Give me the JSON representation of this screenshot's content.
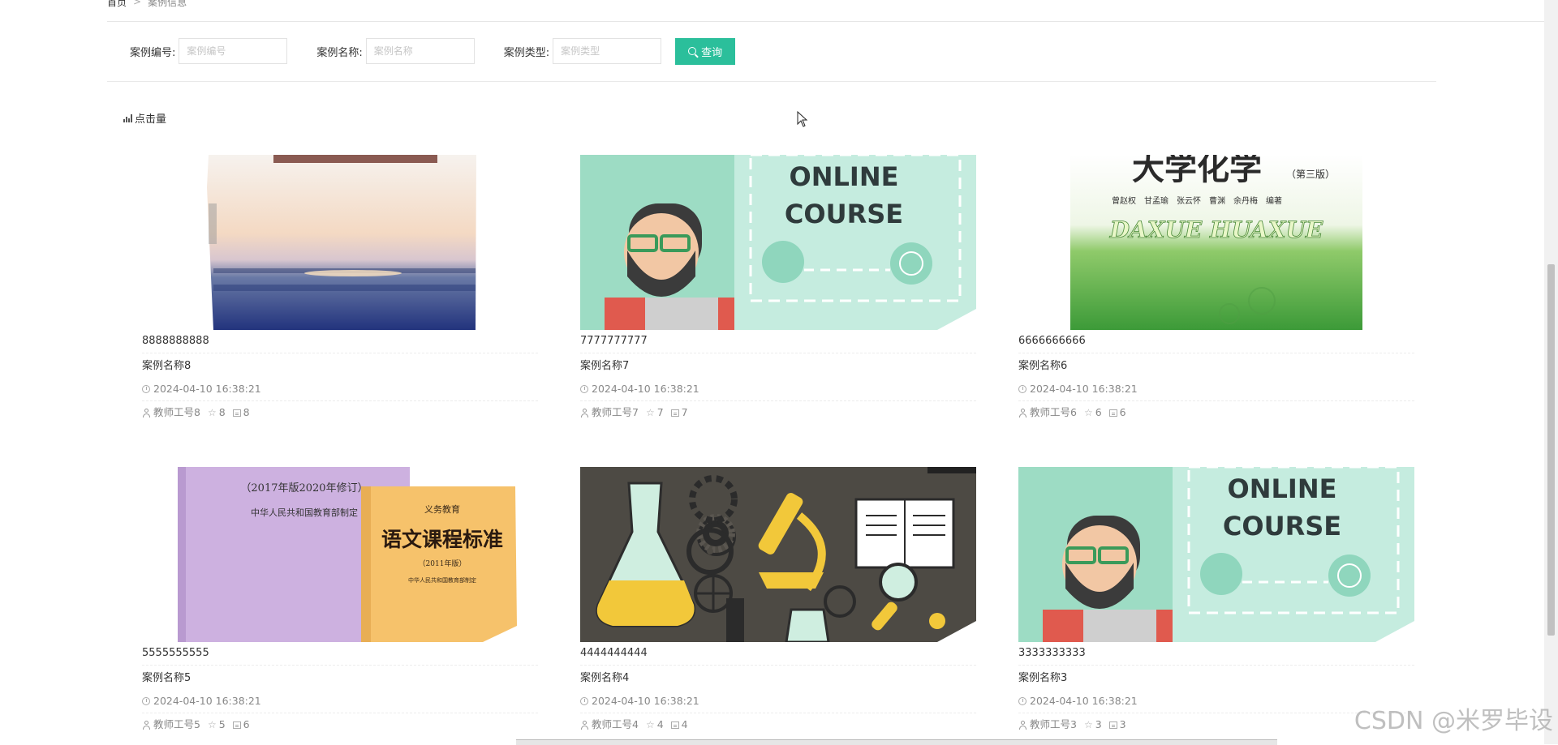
{
  "breadcrumb": {
    "home": "首页",
    "separator": ">",
    "current": "案例信息"
  },
  "search": {
    "fields": [
      {
        "label": "案例编号:",
        "placeholder": "案例编号"
      },
      {
        "label": "案例名称:",
        "placeholder": "案例名称"
      },
      {
        "label": "案例类型:",
        "placeholder": "案例类型"
      }
    ],
    "button_label": "查询"
  },
  "sort": {
    "label": "点击量"
  },
  "cards": [
    {
      "code": "8888888888",
      "name": "案例名称8",
      "time": "2024-04-10 16:38:21",
      "teacher": "教师工号8",
      "stars": "8",
      "comments": "8",
      "image": "textbook-seascape"
    },
    {
      "code": "7777777777",
      "name": "案例名称7",
      "time": "2024-04-10 16:38:21",
      "teacher": "教师工号7",
      "stars": "7",
      "comments": "7",
      "image": "online-course",
      "image_text": [
        "ONLINE",
        "COURSE"
      ]
    },
    {
      "code": "6666666666",
      "name": "案例名称6",
      "time": "2024-04-10 16:38:21",
      "teacher": "教师工号6",
      "stars": "6",
      "comments": "6",
      "image": "chemistry-book",
      "image_text": [
        "大学化学",
        "（第三版）",
        "DAXUE HUAXUE",
        "曾赵权　甘孟瑜　张云怀　曹渊　余丹梅　编著"
      ]
    },
    {
      "code": "5555555555",
      "name": "案例名称5",
      "time": "2024-04-10 16:38:21",
      "teacher": "教师工号5",
      "stars": "5",
      "comments": "6",
      "image": "curriculum-books",
      "image_text": [
        "（2017年版2020年修订）",
        "中华人民共和国教育部制定",
        "义务教育",
        "语文课程标准",
        "（2011年版）",
        "中华人民共和国教育部制定"
      ]
    },
    {
      "code": "4444444444",
      "name": "案例名称4",
      "time": "2024-04-10 16:38:21",
      "teacher": "教师工号4",
      "stars": "4",
      "comments": "4",
      "image": "science-icons"
    },
    {
      "code": "3333333333",
      "name": "案例名称3",
      "time": "2024-04-10 16:38:21",
      "teacher": "教师工号3",
      "stars": "3",
      "comments": "3",
      "image": "online-course",
      "image_text": [
        "ONLINE",
        "COURSE"
      ]
    }
  ],
  "watermark": "CSDN @米罗毕设",
  "colors": {
    "accent": "#2bbf9b",
    "course_bg": "#9ddcc4",
    "science_bg": "#4d4a44"
  }
}
